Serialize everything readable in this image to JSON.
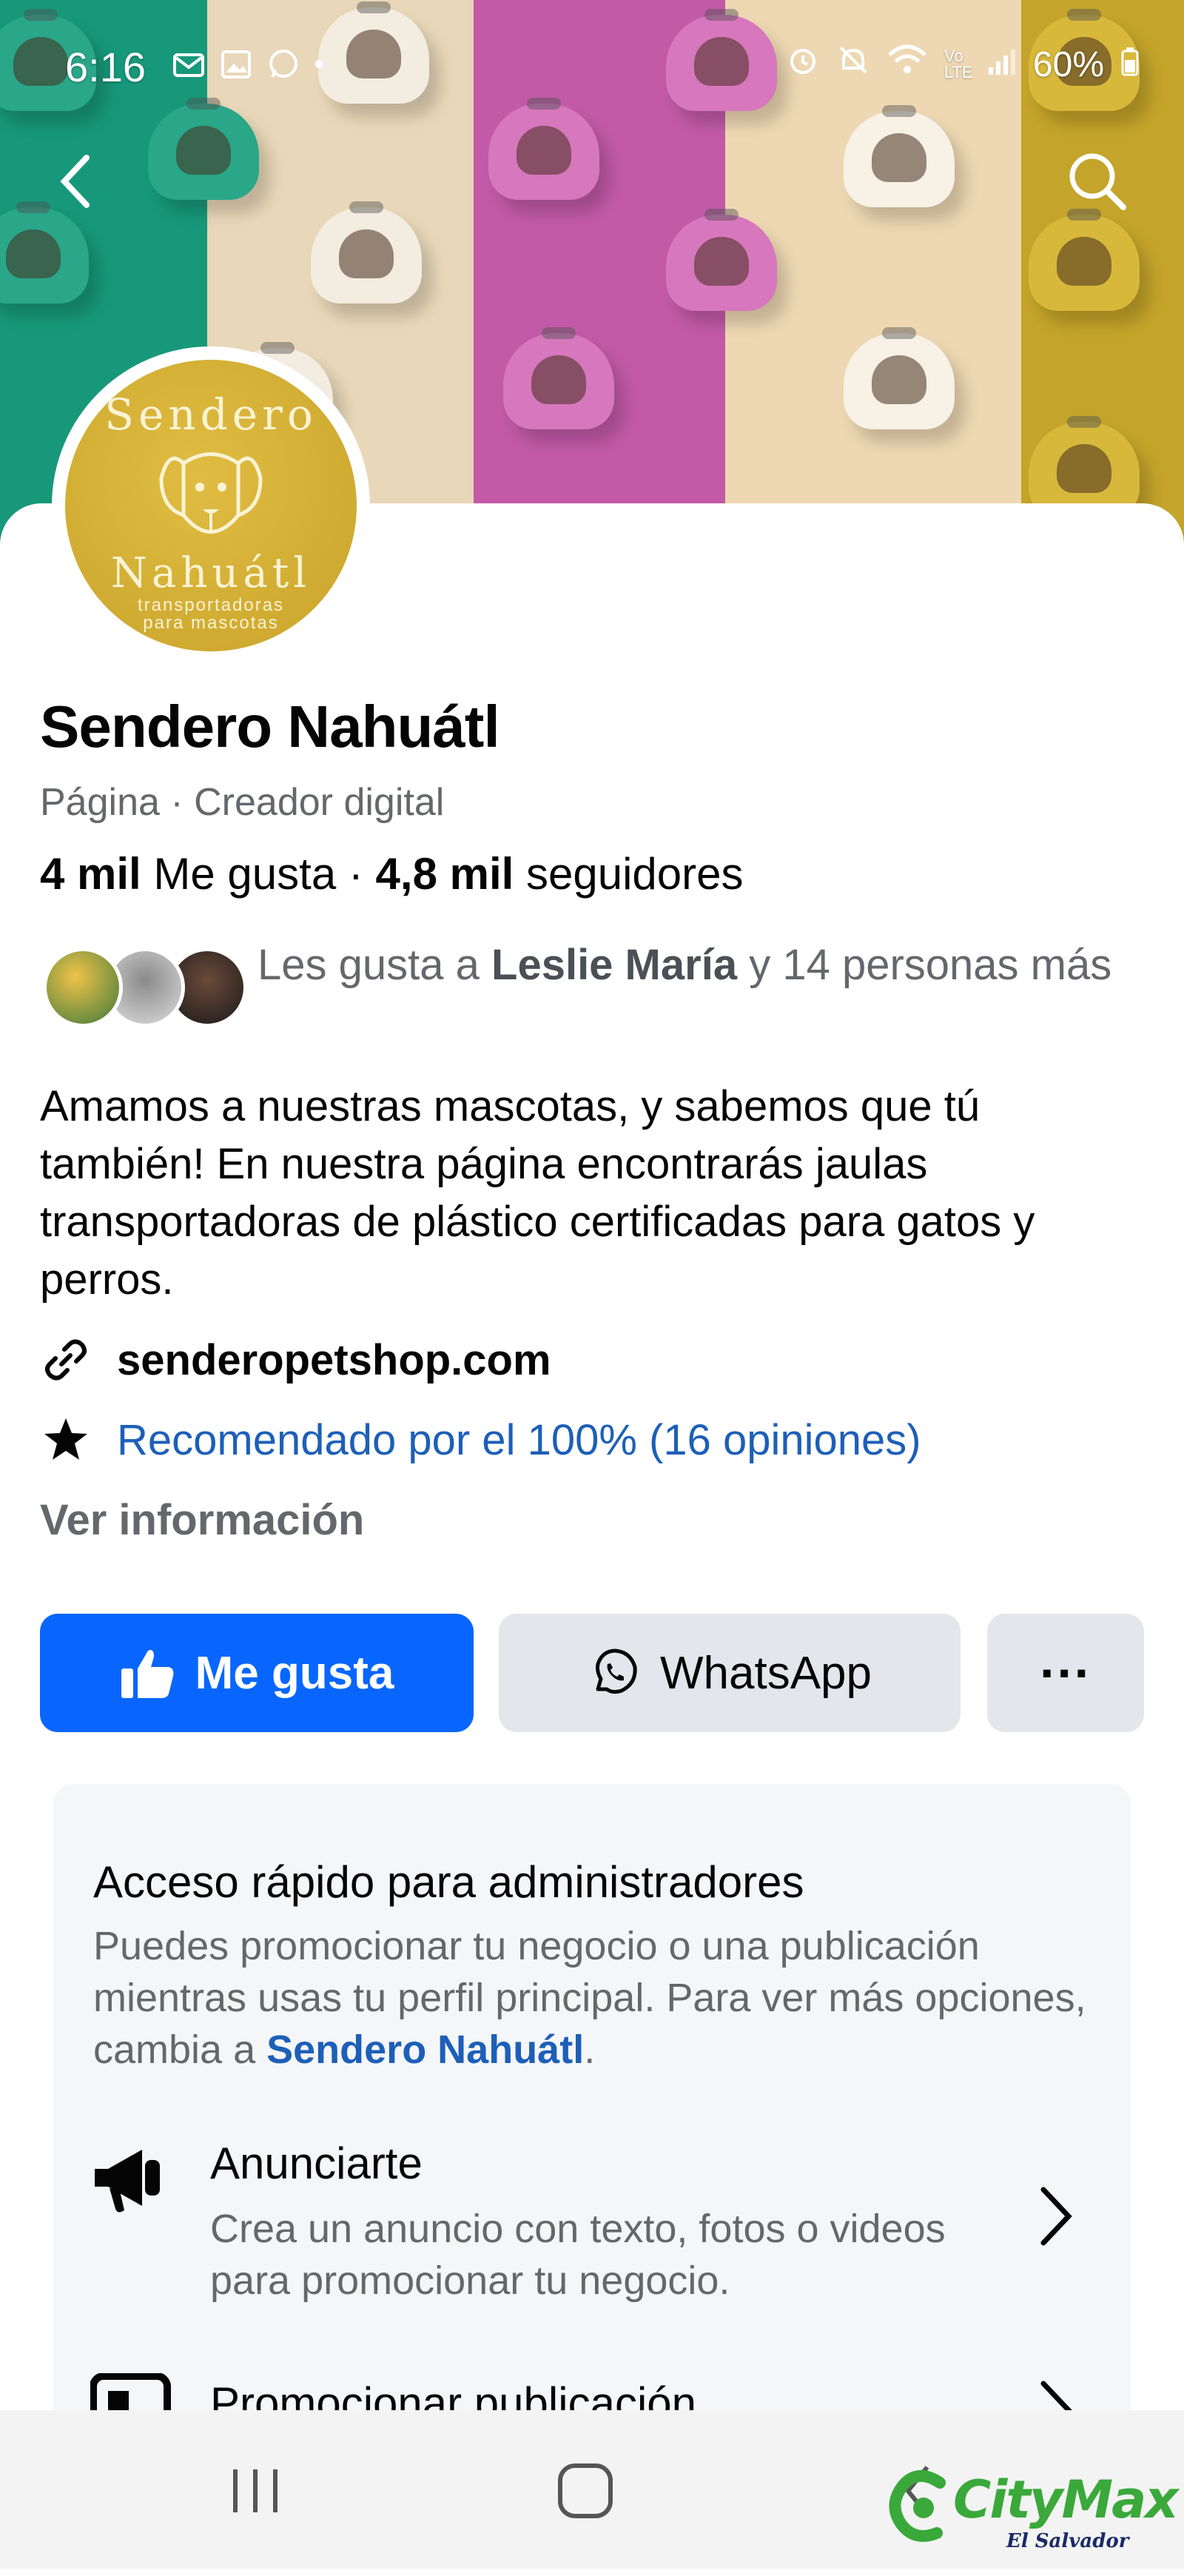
{
  "status_bar": {
    "time": "6:16",
    "battery": "60%",
    "network_label": "Vo LTE"
  },
  "cover": {
    "colors": [
      "#17987a",
      "#e8d7b8",
      "#c25aa8",
      "#eed8b3",
      "#c4a42a"
    ]
  },
  "page": {
    "name": "Sendero Nahuátl",
    "category": "Página · Creador digital",
    "likes_count": "4 mil",
    "likes_label": "Me gusta",
    "followers_count": "4,8 mil",
    "followers_label": "seguidores",
    "separator": " · ",
    "logo": {
      "top": "Sendero",
      "bottom": "Nahuátl",
      "subtitle_1": "transportadoras",
      "subtitle_2": "para mascotas"
    }
  },
  "friends": {
    "prefix": "Les gusta a",
    "name": "Leslie María",
    "suffix": "y 14 personas más"
  },
  "description": "Amamos a nuestras mascotas, y sabemos que tú también! En nuestra página encontrarás jaulas transportadoras de plástico certificadas para gatos y perros.",
  "website": "senderopetshop.com",
  "recommendation": "Recomendado por el 100% (16 opiniones)",
  "see_info": "Ver información",
  "actions": {
    "like": "Me gusta",
    "whatsapp": "WhatsApp",
    "more": "···"
  },
  "admin_card": {
    "title": "Acceso rápido para administradores",
    "text_before": "Puedes promocionar tu negocio o una publicación mientras usas tu perfil principal. Para ver más opciones, cambia a ",
    "link": "Sendero Nahuátl",
    "text_after": ".",
    "items": [
      {
        "title": "Anunciarte",
        "desc": "Crea un anuncio con texto, fotos o videos para promocionar tu negocio."
      },
      {
        "title": "Promocionar publicación",
        "desc": ""
      }
    ]
  },
  "watermark": {
    "brand": "CityMax",
    "sub": "El Salvador"
  },
  "colors": {
    "primary": "#0866ff",
    "link": "#1d5fb8",
    "secondary_text": "#65676b",
    "button_gray": "#e4e6eb"
  }
}
